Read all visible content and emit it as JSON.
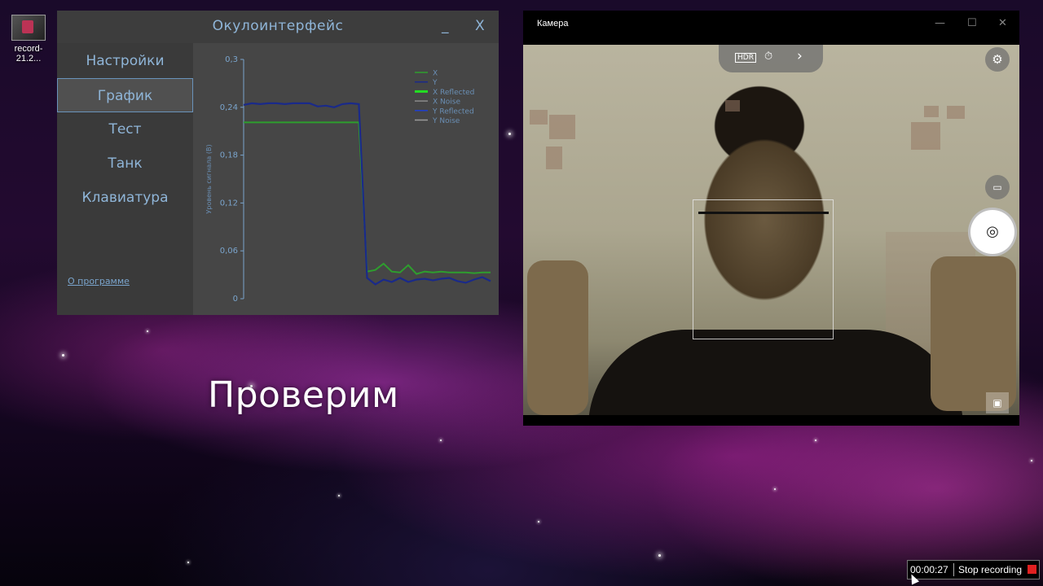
{
  "desktop": {
    "icon_label": "record-21.2...",
    "overlay_text": "Проверим"
  },
  "oculo": {
    "title": "Окулоинтерфейс",
    "minimize": "_",
    "close": "X",
    "nav": [
      "Настройки",
      "График",
      "Тест",
      "Танк",
      "Клавиатура"
    ],
    "active_nav": "График",
    "about": "О программе"
  },
  "chart_data": {
    "type": "line",
    "ylabel": "Уровень сигнала (В)",
    "ylim": [
      0,
      0.3
    ],
    "yticks": [
      "0",
      "0,06",
      "0,12",
      "0,18",
      "0,24",
      "0,3"
    ],
    "ytick_values": [
      0,
      0.06,
      0.12,
      0.18,
      0.24,
      0.3
    ],
    "x": [
      0,
      1,
      2,
      3,
      4,
      5,
      6,
      7,
      8,
      9,
      10,
      11,
      12,
      13,
      14,
      15,
      16,
      17,
      18,
      19,
      20,
      21,
      22,
      23,
      24,
      25,
      26,
      27,
      28,
      29,
      30
    ],
    "series": [
      {
        "name": "X",
        "color": "#2e9e2e",
        "values": [
          0.221,
          0.221,
          0.221,
          0.221,
          0.221,
          0.221,
          0.221,
          0.221,
          0.221,
          0.221,
          0.221,
          0.221,
          0.221,
          0.221,
          0.221,
          0.034,
          0.036,
          0.044,
          0.034,
          0.033,
          0.042,
          0.031,
          0.034,
          0.033,
          0.034,
          0.033,
          0.033,
          0.033,
          0.032,
          0.033,
          0.033
        ]
      },
      {
        "name": "Y",
        "color": "#1a2a8a",
        "values": [
          0.243,
          0.245,
          0.244,
          0.245,
          0.245,
          0.244,
          0.245,
          0.245,
          0.245,
          0.241,
          0.242,
          0.24,
          0.244,
          0.245,
          0.244,
          0.026,
          0.018,
          0.024,
          0.021,
          0.026,
          0.021,
          0.024,
          0.025,
          0.023,
          0.025,
          0.026,
          0.022,
          0.02,
          0.024,
          0.027,
          0.022
        ]
      },
      {
        "name": "X Reflected",
        "color": "#22e022",
        "values": []
      },
      {
        "name": "X Noise",
        "color": "#8a8a8a",
        "values": []
      },
      {
        "name": "Y Reflected",
        "color": "#1f3fd0",
        "values": []
      },
      {
        "name": "Y Noise",
        "color": "#9a9a9a",
        "values": []
      }
    ],
    "legend_position": "top-right",
    "grid": false
  },
  "camera": {
    "title": "Камера",
    "win_min": "—",
    "win_max": "☐",
    "win_close": "✕",
    "hdr": "HDR",
    "timer": "⏱",
    "more": "›",
    "settings": "⚙",
    "video": "▭",
    "shutter": "◎",
    "gallery": "▣"
  },
  "recorder": {
    "time": "00:00:27",
    "stop_label": "Stop recording"
  }
}
